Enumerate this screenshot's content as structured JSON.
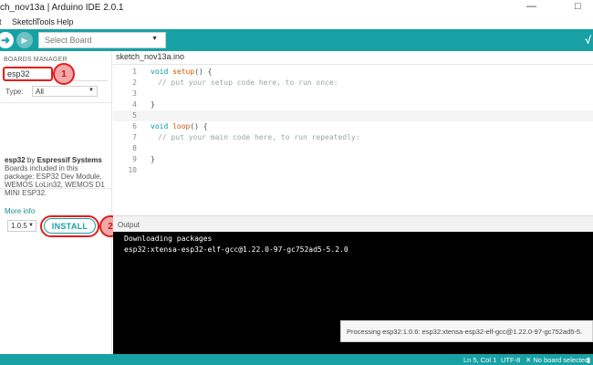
{
  "window": {
    "title": "ch_nov13a | Arduino IDE 2.0.1",
    "minimize_glyph": "—",
    "close_glyph": "□"
  },
  "menu": {
    "items": [
      "t",
      "Sketch",
      "Tools",
      "Help"
    ]
  },
  "toolbar": {
    "board_select_placeholder": "Select Board",
    "upload_icon": "arrow-right-icon",
    "debug_icon": "debug-icon",
    "serial_plotter_icon": "pulse-icon"
  },
  "boards_manager": {
    "header": "BOARDS MANAGER",
    "search_value": "esp32",
    "type_label": "Type:",
    "type_value": "All",
    "board_name": "esp32",
    "by_text": "by",
    "author": "Espressif Systems",
    "description": "Boards included in this package: ESP32 Dev Module, WEMOS LoLin32, WEMOS D1 MINI ESP32.",
    "more_info": "More info",
    "version": "1.0.5",
    "install_label": "INSTALL",
    "step1": "1",
    "step2": "2"
  },
  "editor": {
    "tab_name": "sketch_nov13a.ino",
    "lines": [
      {
        "n": "1",
        "kw": "void",
        "fn": "setup",
        "rest": "() {",
        "comment": ""
      },
      {
        "n": "2",
        "kw": "",
        "fn": "",
        "rest": "",
        "comment": "// put your setup code here, to run once:"
      },
      {
        "n": "3",
        "kw": "",
        "fn": "",
        "rest": "",
        "comment": ""
      },
      {
        "n": "4",
        "kw": "",
        "fn": "",
        "rest": "}",
        "comment": ""
      },
      {
        "n": "5",
        "kw": "",
        "fn": "",
        "rest": "",
        "comment": ""
      },
      {
        "n": "6",
        "kw": "void",
        "fn": "loop",
        "rest": "() {",
        "comment": ""
      },
      {
        "n": "7",
        "kw": "",
        "fn": "",
        "rest": "",
        "comment": "// put your main code here, to run repeatedly:"
      },
      {
        "n": "8",
        "kw": "",
        "fn": "",
        "rest": "",
        "comment": ""
      },
      {
        "n": "9",
        "kw": "",
        "fn": "",
        "rest": "}",
        "comment": ""
      },
      {
        "n": "10",
        "kw": "",
        "fn": "",
        "rest": "",
        "comment": ""
      }
    ]
  },
  "output": {
    "header": "Output",
    "lines": [
      "Downloading packages",
      "esp32:xtensa-esp32-elf-gcc@1.22.0-97-gc752ad5-5.2.0"
    ],
    "notification": "Processing esp32:1.0.6: esp32:xtensa-esp32-elf-gcc@1.22.0-97-gc752ad5-5."
  },
  "status": {
    "position": "Ln 5, Col 1",
    "encoding": "UTF-8",
    "board": "✕ No board selected",
    "notifications_icon": "bell-icon"
  },
  "colors": {
    "accent": "#17a1a5",
    "highlight_red": "#e31d1d",
    "output_bg": "#000000"
  }
}
